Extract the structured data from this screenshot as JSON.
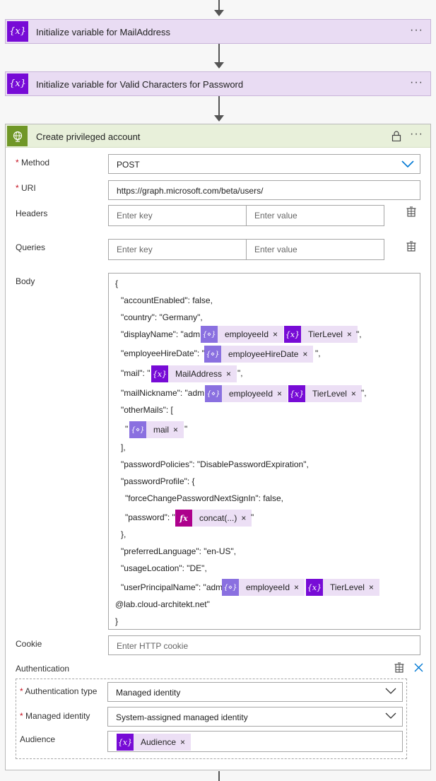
{
  "steps": [
    {
      "title": "Initialize variable for MailAddress"
    },
    {
      "title": "Initialize variable for Valid Characters for Password"
    }
  ],
  "card": {
    "title": "Create privileged account",
    "method": {
      "label": "Method",
      "value": "POST"
    },
    "uri": {
      "label": "URI",
      "value": "https://graph.microsoft.com/beta/users/"
    },
    "headers": {
      "label": "Headers",
      "key_ph": "Enter key",
      "value_ph": "Enter value"
    },
    "queries": {
      "label": "Queries",
      "key_ph": "Enter key",
      "value_ph": "Enter value"
    },
    "body_label": "Body",
    "body": {
      "l1": "{",
      "l2": "\"accountEnabled\": false,",
      "l3": "\"country\": \"Germany\",",
      "l4": "\"displayName\": \"adm",
      "l4_end": "\",",
      "l5": "\"employeeHireDate\": \"",
      "l5_end": "\",",
      "l6": "\"mail\": \"",
      "l6_end": "\",",
      "l7": "\"mailNickname\": \"adm",
      "l7_end": "\",",
      "l8": "\"otherMails\": [",
      "l9": "\"",
      "l9_end": "\"",
      "l10": "],",
      "l11": "\"passwordPolicies\": \"DisablePasswordExpiration\",",
      "l12": "\"passwordProfile\": {",
      "l13": "\"forceChangePasswordNextSignIn\": false,",
      "l14": "\"password\": \"",
      "l14_end": "\"",
      "l15": "},",
      "l16": "\"preferredLanguage\": \"en-US\",",
      "l17": "\"usageLocation\": \"DE\",",
      "l18": "\"userPrincipalName\": \"adm",
      "l19": "@lab.cloud-architekt.net\"",
      "l20": "}"
    },
    "tokens": {
      "employeeId": "employeeId",
      "tierLevel": "TierLevel",
      "employeeHireDate": "employeeHireDate",
      "mailAddress": "MailAddress",
      "mail": "mail",
      "concat": "concat(...)"
    },
    "cookie": {
      "label": "Cookie",
      "placeholder": "Enter HTTP cookie"
    },
    "auth": {
      "label": "Authentication",
      "type_label": "Authentication type",
      "type_value": "Managed identity",
      "identity_label": "Managed identity",
      "identity_value": "System-assigned managed identity",
      "audience_label": "Audience",
      "audience_token": "Audience"
    }
  },
  "icons": {
    "variable": "{x}",
    "trigger": "{⋄}",
    "fx": "fx",
    "remove": "×",
    "more": "···"
  }
}
